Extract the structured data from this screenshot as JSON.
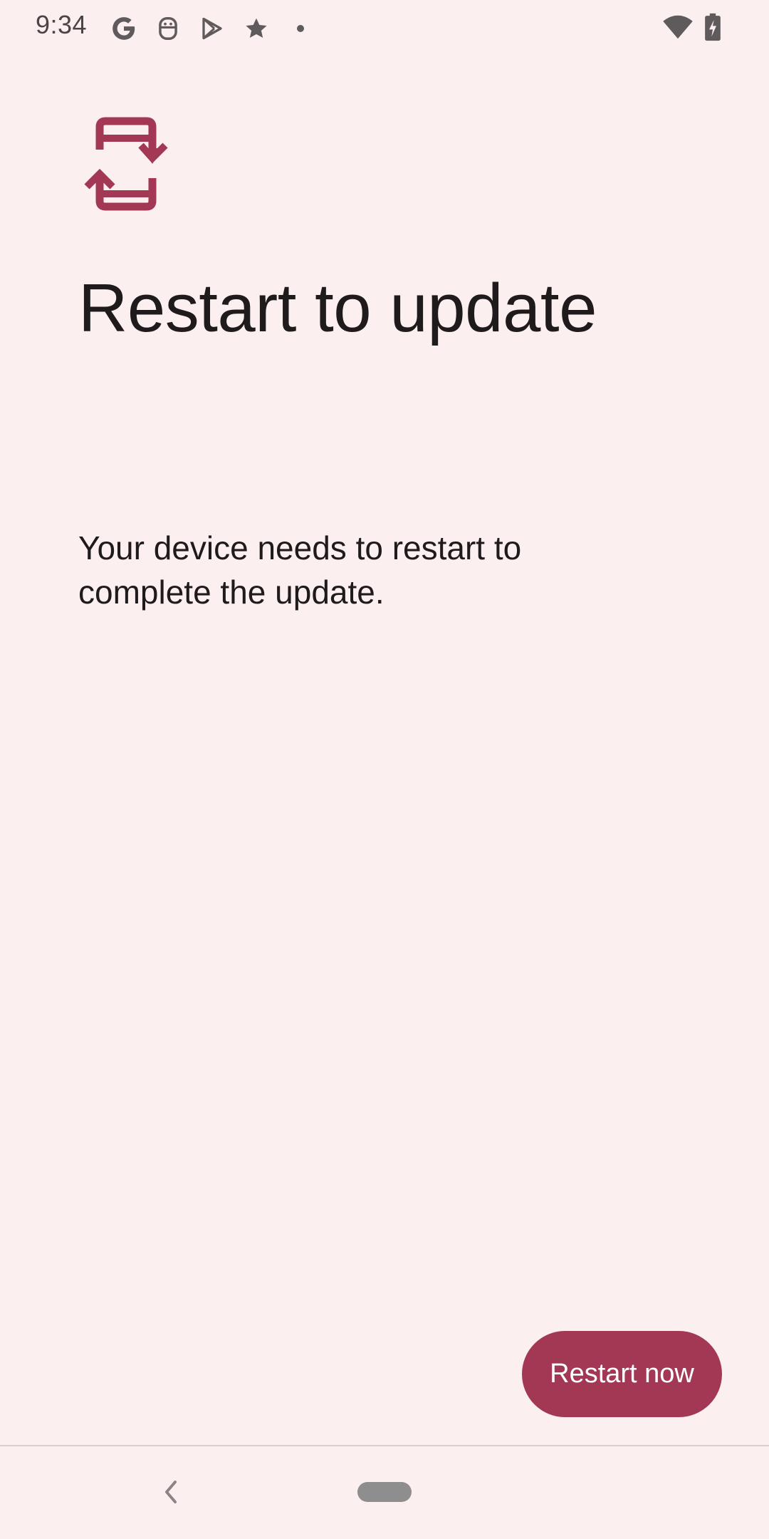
{
  "status_bar": {
    "time": "9:34",
    "left_icons": [
      "google-g-icon",
      "assistant-face-icon",
      "play-store-icon",
      "star-icon",
      "dot-icon"
    ],
    "right_icons": [
      "wifi-icon",
      "battery-charging-icon"
    ]
  },
  "content": {
    "icon": "system-update-icon",
    "title": "Restart to update",
    "description": "Your device needs to restart to complete the update."
  },
  "actions": {
    "restart_label": "Restart now"
  },
  "colors": {
    "background": "#fcefef",
    "accent": "#a33855",
    "text": "#1f1b1c"
  },
  "nav_bar": {
    "back_icon": "back-chevron-icon",
    "home_handle": "home-pill"
  }
}
